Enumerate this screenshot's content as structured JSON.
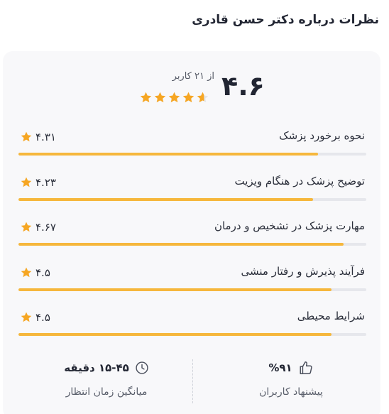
{
  "page": {
    "title": "نظرات درباره دکتر حسن قادری"
  },
  "summary": {
    "average": "۴.۶",
    "users_text": "از ۲۱ کاربر",
    "stars_filled": 4,
    "star_fraction": 0.6,
    "star_color": "#f6a623"
  },
  "ratings": [
    {
      "label": "نحوه برخورد پزشک",
      "score": "۴.۳۱",
      "fraction": 0.862
    },
    {
      "label": "توضیح پزشک در هنگام ویزیت",
      "score": "۴.۲۳",
      "fraction": 0.846
    },
    {
      "label": "مهارت پزشک در تشخیص و درمان",
      "score": "۴.۶۷",
      "fraction": 0.934
    },
    {
      "label": "فرآیند پذیرش و رفتار منشی",
      "score": "۴.۵",
      "fraction": 0.9
    },
    {
      "label": "شرایط محیطی",
      "score": "۴.۵",
      "fraction": 0.9
    }
  ],
  "footer": {
    "recommend": {
      "value": "%۹۱",
      "label": "پیشنهاد کاربران",
      "icon": "thumbs-up-icon"
    },
    "wait_time": {
      "value": "۱۵-۴۵ دقیقه",
      "label": "میانگین زمان انتظار",
      "icon": "clock-icon"
    }
  },
  "colors": {
    "bar_fill": "#f6b73c",
    "bar_track": "#e6e7ec",
    "card_bg": "#f8f8fa"
  }
}
